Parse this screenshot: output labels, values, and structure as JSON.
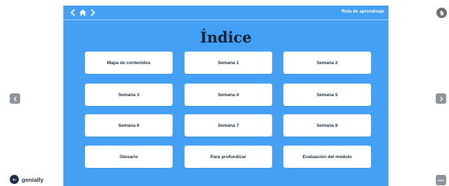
{
  "header": {
    "route_label": "Ruta de aprendizaje",
    "back_icon": "chevron-left-icon",
    "home_icon": "home-icon",
    "forward_icon": "chevron-right-icon"
  },
  "title": "Índice",
  "buttons": [
    "Mapa de contenidos",
    "Semana 1",
    "Semana 2",
    "Semana 3",
    "Semana 4",
    "Semana 5",
    "Semana 6",
    "Semana 7",
    "Semana 8",
    "Glosario",
    "Para profundizar",
    "Evaluación del módulo"
  ],
  "brand": {
    "name": "genially",
    "logo_icon": "genially-logo-icon"
  },
  "colors": {
    "slide_bg": "#43a0f5",
    "card_bg": "#ffffff",
    "title_color": "#0b1f33",
    "side_button": "#8e9499"
  }
}
